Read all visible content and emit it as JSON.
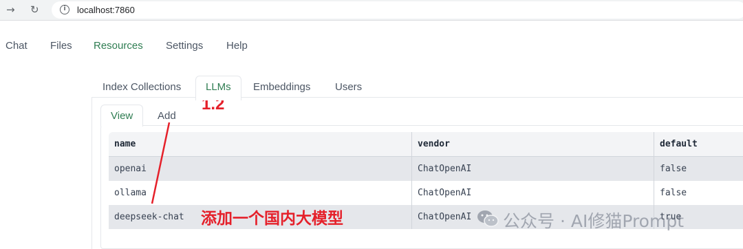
{
  "browser": {
    "url": "localhost:7860",
    "forward_icon": "arrow-right",
    "reload_icon": "reload",
    "info_icon": "info-circle"
  },
  "top_nav": {
    "tabs": [
      {
        "label": "Chat",
        "active": false
      },
      {
        "label": "Files",
        "active": false
      },
      {
        "label": "Resources",
        "active": true
      },
      {
        "label": "Settings",
        "active": false
      },
      {
        "label": "Help",
        "active": false
      }
    ]
  },
  "resource_tabs": [
    {
      "label": "Index Collections",
      "active": false
    },
    {
      "label": "LLMs",
      "active": true
    },
    {
      "label": "Embeddings",
      "active": false
    },
    {
      "label": "Users",
      "active": false
    }
  ],
  "llm_tabs": [
    {
      "label": "View",
      "active": true
    },
    {
      "label": "Add",
      "active": false
    }
  ],
  "table": {
    "columns": [
      "name",
      "vendor",
      "default"
    ],
    "rows": [
      {
        "name": "openai",
        "vendor": "ChatOpenAI",
        "default": "false",
        "selected": true
      },
      {
        "name": "ollama",
        "vendor": "ChatOpenAI",
        "default": "false",
        "selected": false
      },
      {
        "name": "deepseek-chat",
        "vendor": "ChatOpenAI",
        "default": "true",
        "selected": true
      }
    ]
  },
  "annotations": {
    "step": "1.2",
    "note": "添加一个国内大模型",
    "color": "#e5202a"
  },
  "watermark": {
    "text": "公众号 · AI修猫Prompt",
    "icon": "wechat-icon"
  },
  "colors": {
    "accent": "#2f7d52",
    "selected_row": "#e5e7eb",
    "header_row": "#f3f4f6"
  }
}
